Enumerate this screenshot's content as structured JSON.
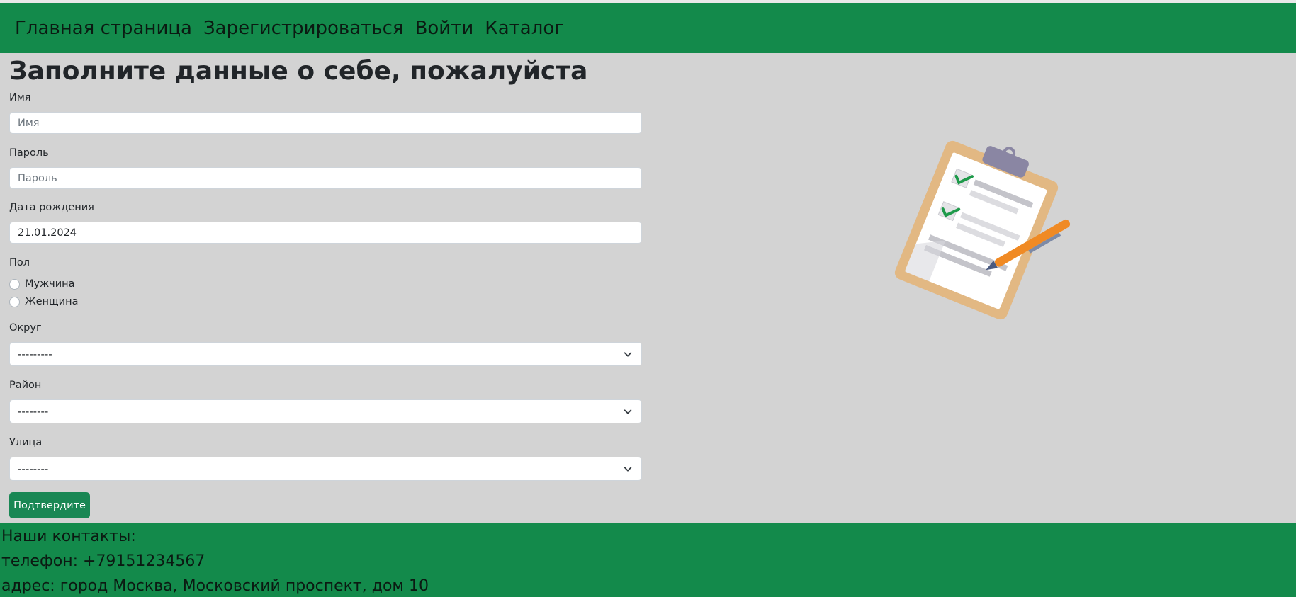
{
  "nav": {
    "home": "Главная страница",
    "register": "Зарегистрироваться",
    "login": "Войти",
    "catalog": "Каталог"
  },
  "form": {
    "title": "Заполните данные о себе, пожалуйста",
    "name_label": "Имя",
    "name_placeholder": "Имя",
    "password_label": "Пароль",
    "password_placeholder": "Пароль",
    "birthdate_label": "Дата рождения",
    "birthdate_value": "21.01.2024",
    "gender_label": "Пол",
    "gender_options": [
      "Мужчина",
      "Женщина"
    ],
    "district_label": "Округ",
    "district_value": "---------",
    "area_label": "Район",
    "area_value": "--------",
    "street_label": "Улица",
    "street_value": "--------",
    "submit_label": "Подтвердите"
  },
  "illustration": {
    "icon": "clipboard-checklist-icon"
  },
  "footer": {
    "heading": "Наши контакты:",
    "phone": "телефон: +79151234567",
    "address": "адрес: город Москва, Московский проспект, дом 10"
  },
  "colors": {
    "brand_green": "#138a4b",
    "button_green": "#198754",
    "background": "#d3d3d3"
  }
}
